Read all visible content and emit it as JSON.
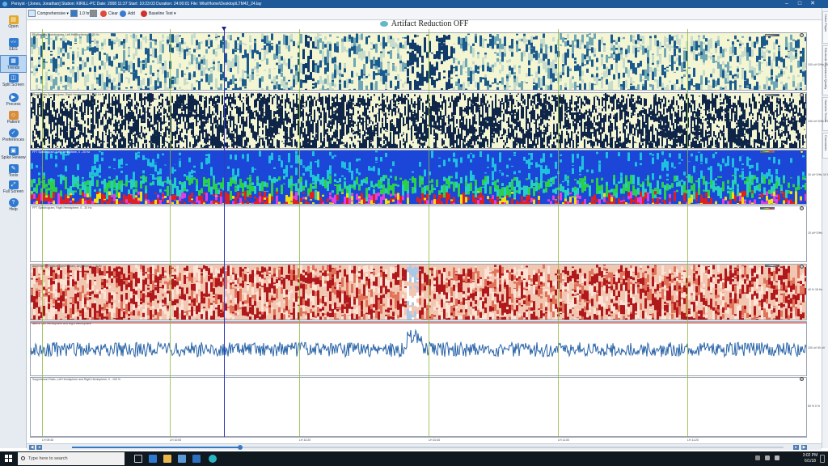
{
  "window": {
    "title": "Persyst - [Jones, Jonathan]   Station: KIRILL-PC  Date: 2008 11:37  Start: 10:23:03  Duration: 24:00:01  File: WkstHome\\Desktop\\LTM42_24.lay",
    "minimize": "–",
    "maximize": "□",
    "close": "✕"
  },
  "sidebar": {
    "items": [
      {
        "label": "Open",
        "icon": "folder-open-icon"
      },
      {
        "label": "EEG",
        "icon": "eeg-icon"
      },
      {
        "label": "Trends",
        "icon": "trends-icon"
      },
      {
        "label": "Split Screen",
        "icon": "split-screen-icon"
      },
      {
        "label": "Process",
        "icon": "process-icon"
      },
      {
        "label": "Patient",
        "icon": "patient-icon"
      },
      {
        "label": "Preferences",
        "icon": "preferences-icon"
      },
      {
        "label": "Spike Review",
        "icon": "spike-review-icon"
      },
      {
        "label": "Tools",
        "icon": "tools-icon"
      },
      {
        "label": "Full Screen",
        "icon": "full-screen-icon"
      },
      {
        "label": "Help",
        "icon": "help-icon"
      }
    ],
    "active": "Trends"
  },
  "toolbar": {
    "panel_select": "Comprehensive",
    "zoom": "1.0 hr",
    "clear": "Clear",
    "add": "Add",
    "baseline": "Baseline Test"
  },
  "header": {
    "status": "Artifact Reduction OFF"
  },
  "right_tabs": [
    "Video Player",
    "Electrode Impedance Quality",
    "Numeric Trends",
    "Comments"
  ],
  "panels": {
    "rhythmicity_left": {
      "title": "Rhythmicity Spectrogram, Left Hemisphere, 1 - 25 Hz",
      "scale": "100 uV^2/Hz 20 Hz 5 Hz"
    },
    "rhythmicity_right": {
      "title": "Rhythmicity Spectrogram, Right Hemisphere, 1 - 25 Hz",
      "scale": "100 uV^2/Hz 5 Hz"
    },
    "fft_left": {
      "title": "FFT Spectrogram, Left Hemisphere, 0 - 20 Hz",
      "scale": "10 uV^2/Hz 10 Hz"
    },
    "fft_right": {
      "title": "FFT Spectrogram, Right Hemisphere, 0 - 20 Hz",
      "scale": "10 uV^2/Hz"
    },
    "asymmetry": {
      "title": "Asymmetry, Relative Spectrogram, Avg Hemi, 1 - 18 Hz",
      "scale": "40 % 18 Hz"
    },
    "aeeg": {
      "title": "aEEG, Left Hemisphere and Right Hemisphere",
      "scale": "100 uV 50 uV"
    },
    "suppression": {
      "title": "Suppression Ratio, Left Hemisphere and Right Hemisphere, 0 - 100 %",
      "scale": "50 % 0 %"
    }
  },
  "time_axis": {
    "labels": [
      "LH 09:40",
      "LH 10:00",
      "LH 10:20",
      "LH 10:40",
      "LH 11:00",
      "LH 11:20"
    ]
  },
  "taskbar": {
    "search_placeholder": "Type here to search",
    "time": "3:02 PM",
    "date": "6/1/18"
  },
  "colors": {
    "accent": "#2f7ad0",
    "titlebar": "#1e5a9a",
    "trace_blue": "#2a64a8",
    "grid_green": "#8fb83d"
  }
}
